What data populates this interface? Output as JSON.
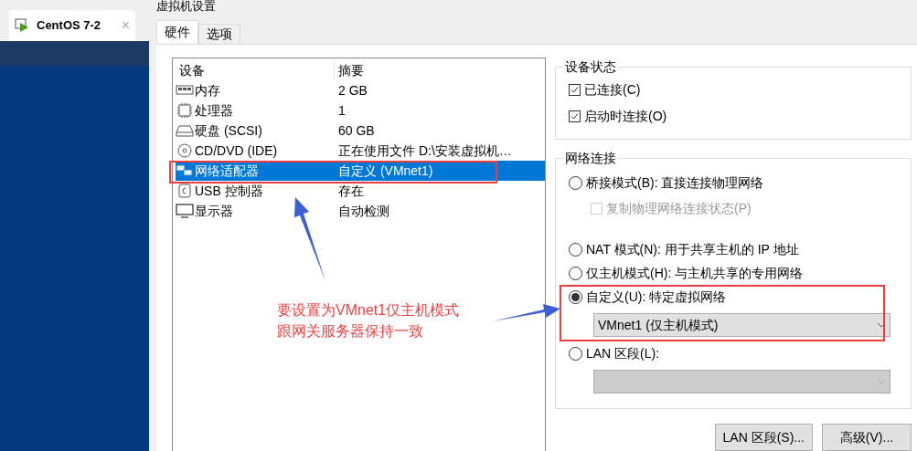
{
  "window": {
    "title": "虚拟机设置"
  },
  "vm_tabs": [
    {
      "label": "CentOS 7-2",
      "selected": true,
      "close": "×"
    }
  ],
  "tabs": [
    {
      "label": "硬件",
      "selected": true
    },
    {
      "label": "选项",
      "selected": false
    }
  ],
  "devices": {
    "columns": [
      "设备",
      "摘要"
    ],
    "rows": [
      {
        "kind": "memory",
        "name": "内存",
        "summary": "2 GB",
        "selected": false
      },
      {
        "kind": "cpu",
        "name": "处理器",
        "summary": "1",
        "selected": false
      },
      {
        "kind": "disk",
        "name": "硬盘 (SCSI)",
        "summary": "60 GB",
        "selected": false
      },
      {
        "kind": "cd",
        "name": "CD/DVD (IDE)",
        "summary": "正在使用文件 D:\\安装虚拟机…",
        "selected": false
      },
      {
        "kind": "network",
        "name": "网络适配器",
        "summary": "自定义 (VMnet1)",
        "selected": true
      },
      {
        "kind": "usb",
        "name": "USB 控制器",
        "summary": "存在",
        "selected": false
      },
      {
        "kind": "display",
        "name": "显示器",
        "summary": "自动检测",
        "selected": false
      }
    ]
  },
  "device_status": {
    "title": "设备状态",
    "items": [
      {
        "label": "已连接(C)",
        "checked": true
      },
      {
        "label": "启动时连接(O)",
        "checked": true
      }
    ]
  },
  "network": {
    "title": "网络连接",
    "options": [
      {
        "label": "桥接模式(B): 直接连接物理网络",
        "selected": false,
        "sub": {
          "kind": "checkbox",
          "label": "复制物理网络连接状态(P)",
          "checked": false,
          "disabled": true
        }
      },
      {
        "label": "NAT 模式(N): 用于共享主机的 IP 地址",
        "selected": false
      },
      {
        "label": "仅主机模式(H): 与主机共享的专用网络",
        "selected": false
      },
      {
        "label": "自定义(U): 特定虚拟网络",
        "selected": true,
        "sub": {
          "kind": "select",
          "value": "VMnet1 (仅主机模式)",
          "disabled": false
        }
      },
      {
        "label": "LAN 区段(L):",
        "selected": false,
        "sub": {
          "kind": "select",
          "disabled": true
        }
      }
    ]
  },
  "buttons": [
    "LAN 区段(S)...",
    "高级(V)..."
  ],
  "annotation": {
    "lines": [
      "要设置为VMnet1仅主机模式",
      "跟网关服务器保持一致"
    ]
  }
}
